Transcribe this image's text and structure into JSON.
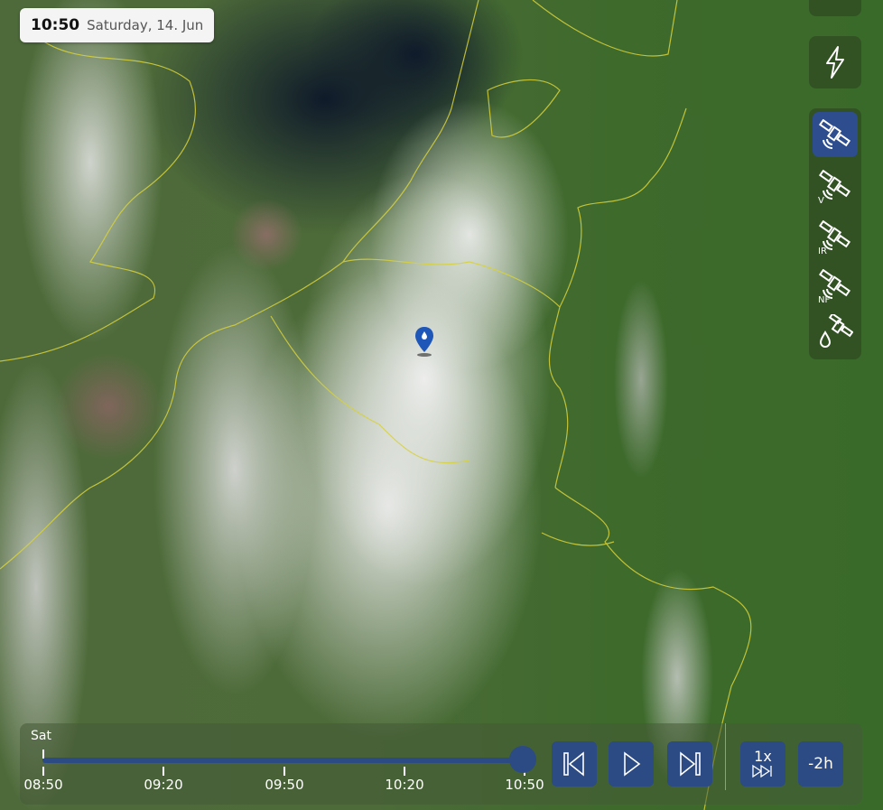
{
  "header": {
    "time": "10:50",
    "date": "Saturday, 14. Jun"
  },
  "layers": {
    "lightning": "lightning-layer",
    "satellite": [
      {
        "id": "sat-default",
        "label": "",
        "active": true
      },
      {
        "id": "sat-visible",
        "label": "V",
        "active": false
      },
      {
        "id": "sat-infrared",
        "label": "IR",
        "active": false
      },
      {
        "id": "sat-nightfog",
        "label": "NF",
        "active": false
      },
      {
        "id": "sat-water-vapor",
        "label": "",
        "active": false
      }
    ]
  },
  "player": {
    "day": "Sat",
    "ticks": [
      "08:50",
      "09:20",
      "09:50",
      "10:20",
      "10:50"
    ],
    "progress": 1.0,
    "speed": "1x",
    "back": "-2h"
  },
  "colors": {
    "accent": "#2c4a84",
    "border": "#d8d23a"
  }
}
